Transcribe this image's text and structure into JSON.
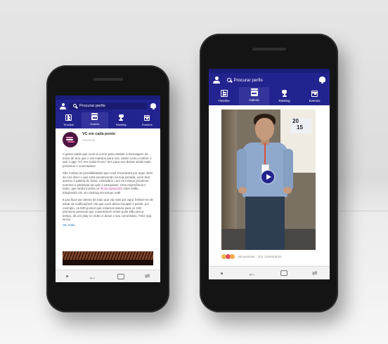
{
  "app": {
    "search_placeholder": "Procurar perfis",
    "tabs": [
      {
        "label": "Timeline",
        "icon": "timeline-icon"
      },
      {
        "label": "Galeria",
        "icon": "gallery-icon"
      },
      {
        "label": "Ranking",
        "icon": "trophy-icon"
      },
      {
        "label": "Eventos",
        "icon": "calendar-icon"
      }
    ],
    "active_tab_left": "Galeria",
    "colors": {
      "header": "#23238f",
      "active_tab": "#34349c",
      "hashtag": "#c63a8e",
      "link": "#1d6fc2"
    }
  },
  "left_phone": {
    "post": {
      "author": "VC em cada ponto",
      "date": "10/01/2019",
      "paragraphs": [
        "A gente sabia que você ia correr para assistir à mensagem de início de ano que o LM mandou para nós, assim como conferir o que o app \"VC em Cada Ponto\" tem para nos deixar ainda mais próximos e conectados!",
        "São muitas as possibilidades que você encontrará por aqui! Além do nos dizer o que está acontecendo na sua jornada, você terá acesso à galeria de fotos, calendário com os nossos próximos eventos e participar de quiz e pesquisas. Uma experiência e tanto, que ainda mostra os",
        "E pra ficar por dentro de tudo que vai rolar por aqui, lembre-se de ativar as notificações! Vai que você deixa escapar e perde, por exemplo, os 500 pontos que estamos dando para os 100 primeiros pessoas que comentarem neste post! Não perca tempo, dá um play no vídeo e deixe o seu comentário. Feliz App Novo!"
      ],
      "hashtag": "#loucospeponto",
      "paragraph2_tail": "mais estão integrando em um ranking em tempo real!",
      "more_link": "Ver mais"
    }
  },
  "right_phone": {
    "video": {
      "poster_text_top": "20",
      "poster_text_bottom": "15"
    },
    "reactions_text": "68 pessoas · 101 comentários"
  }
}
